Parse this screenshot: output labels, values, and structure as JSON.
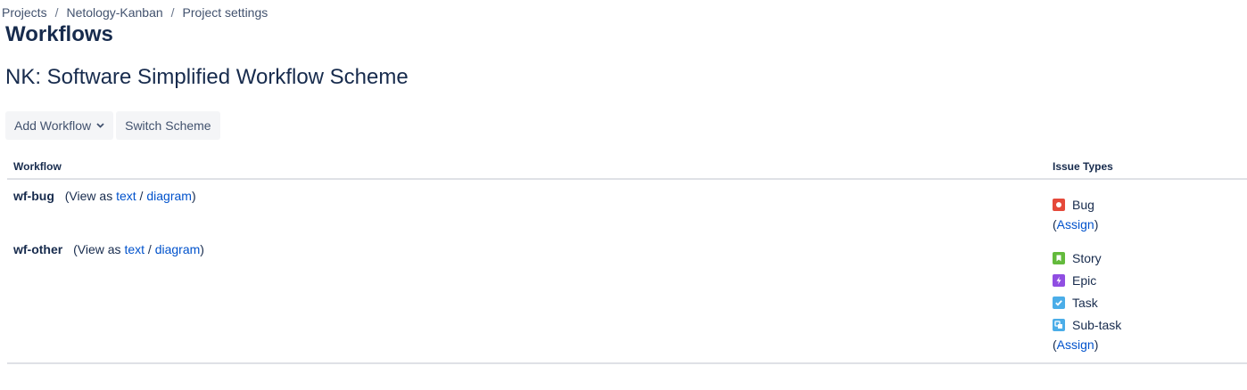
{
  "breadcrumb": {
    "items": [
      "Projects",
      "Netology-Kanban",
      "Project settings"
    ],
    "separator": "/"
  },
  "page_title": "Workflows",
  "scheme_title": "NK: Software Simplified Workflow Scheme",
  "toolbar": {
    "add_workflow_label": "Add Workflow",
    "switch_scheme_label": "Switch Scheme"
  },
  "table": {
    "headers": {
      "workflow": "Workflow",
      "issue_types": "Issue Types"
    },
    "rows": [
      {
        "name": "wf-bug",
        "view_prefix": "(View as ",
        "view_text": "text",
        "view_sep": " / ",
        "view_diagram": "diagram",
        "view_suffix": ")",
        "issue_types": [
          {
            "label": "Bug",
            "icon": "bug-icon",
            "color": "#e5493a"
          }
        ],
        "assign_open": "(",
        "assign_label": "Assign",
        "assign_close": ")"
      },
      {
        "name": "wf-other",
        "view_prefix": "(View as ",
        "view_text": "text",
        "view_sep": " / ",
        "view_diagram": "diagram",
        "view_suffix": ")",
        "issue_types": [
          {
            "label": "Story",
            "icon": "story-icon",
            "color": "#63ba3c"
          },
          {
            "label": "Epic",
            "icon": "epic-icon",
            "color": "#904ee2"
          },
          {
            "label": "Task",
            "icon": "task-icon",
            "color": "#4bade8"
          },
          {
            "label": "Sub-task",
            "icon": "subtask-icon",
            "color": "#4bade8"
          }
        ],
        "assign_open": "(",
        "assign_label": "Assign",
        "assign_close": ")"
      }
    ]
  },
  "colors": {
    "link": "#0052cc",
    "text": "#172b4d",
    "button_bg": "#f4f5f7",
    "divider": "#dfe1e6"
  }
}
